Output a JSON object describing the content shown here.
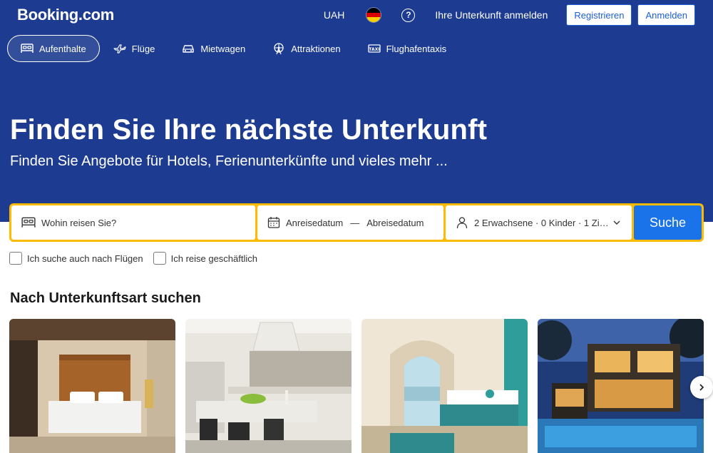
{
  "header": {
    "logo": "Booking.com",
    "currency": "UAH",
    "help_glyph": "?",
    "list_property": "Ihre Unterkunft anmelden",
    "register": "Registrieren",
    "sign_in": "Anmelden",
    "flag_colors": [
      "#000000",
      "#dd0000",
      "#ffce00"
    ]
  },
  "nav": {
    "items": [
      {
        "label": "Aufenthalte",
        "icon": "bed-icon"
      },
      {
        "label": "Flüge",
        "icon": "plane-icon"
      },
      {
        "label": "Mietwagen",
        "icon": "car-icon"
      },
      {
        "label": "Attraktionen",
        "icon": "ferris-wheel-icon"
      },
      {
        "label": "Flughafentaxis",
        "icon": "taxi-icon"
      }
    ]
  },
  "hero": {
    "title": "Finden Sie Ihre nächste Unterkunft",
    "subtitle": "Finden Sie Angebote für Hotels, Ferienunterkünfte und vieles mehr ..."
  },
  "search": {
    "destination_placeholder": "Wohin reisen Sie?",
    "checkin": "Anreisedatum",
    "separator": "—",
    "checkout": "Abreisedatum",
    "guests": "2 Erwachsene · 0 Kinder · 1 Zimmer",
    "button": "Suche"
  },
  "options": {
    "flights": "Ich suche auch nach Flügen",
    "business": "Ich reise geschäftlich"
  },
  "property_types": {
    "title": "Nach Unterkunftsart suchen"
  },
  "colors": {
    "brand_blue": "#1c3b91",
    "search_yellow": "#febb02",
    "action_blue": "#1a73e8"
  }
}
